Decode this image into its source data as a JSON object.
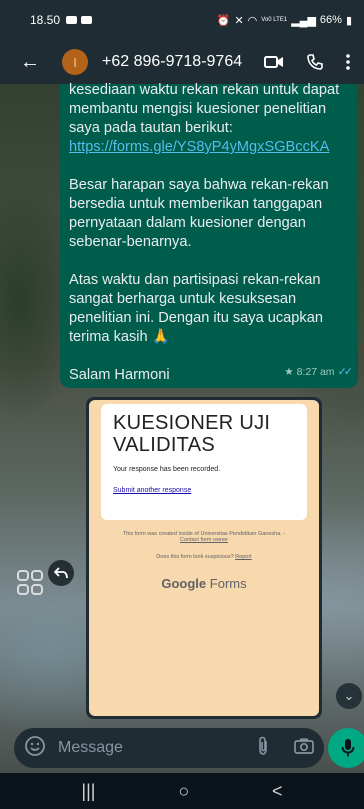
{
  "status_bar": {
    "time": "18.50",
    "battery": "66%",
    "signal_text": "Vo0 LTE1"
  },
  "header": {
    "avatar_letter": "I",
    "contact": "+62 896-9718-9764"
  },
  "message": {
    "p1": "kesediaan waktu rekan rekan untuk dapat membantu mengisi kuesioner penelitian saya pada  tautan berikut:",
    "link": "https://forms.gle/YS8yP4yMgxSGBccKA",
    "p2": "Besar harapan saya bahwa rekan-rekan bersedia untuk memberikan tanggapan pernyataan dalam kuesioner dengan sebenar-benarnya.",
    "p3": "Atas waktu dan partisipasi rekan-rekan sangat berharga untuk kesuksesan penelitian ini. Dengan itu saya ucapkan terima kasih 🙏",
    "signoff": "Salam Harmoni",
    "time": "8:27 am",
    "star": "★"
  },
  "form_preview": {
    "title": "KUESIONER UJI VALIDITAS",
    "recorded": "Your response has been recorded.",
    "submit_another": "Submit another response",
    "footer1": "This form was created inside of Universitas Pendidikan Ganesha. -",
    "contact_owner": "Contact form owner",
    "suspicious": "Does this form look suspicious?",
    "report": "Report",
    "logo_google": "Google",
    "logo_forms": "Forms"
  },
  "input": {
    "placeholder": "Message"
  },
  "nav": {
    "recents": "|||",
    "home": "○",
    "back": "<"
  },
  "colors": {
    "bubble": "#005c4b",
    "header": "#1f2c33",
    "accent": "#00a884",
    "link": "#53bdeb",
    "form_bg": "#f8d8ad"
  }
}
